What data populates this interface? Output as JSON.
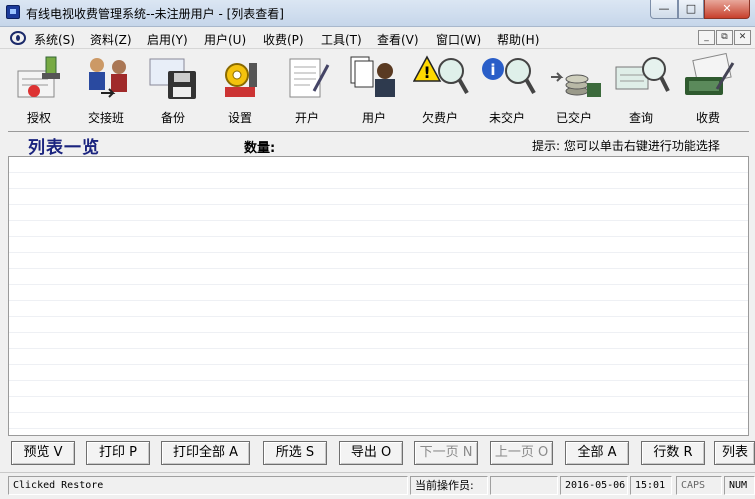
{
  "window": {
    "title": "有线电视收费管理系统--未注册用户 - [列表查看]"
  },
  "menu": [
    {
      "label": "系统(S)"
    },
    {
      "label": "资料(Z)"
    },
    {
      "label": "启用(Y)"
    },
    {
      "label": "用户(U)"
    },
    {
      "label": "收费(P)"
    },
    {
      "label": "工具(T)"
    },
    {
      "label": "查看(V)"
    },
    {
      "label": "窗口(W)"
    },
    {
      "label": "帮助(H)"
    }
  ],
  "toolbar": [
    {
      "label": "授权",
      "icon": "authorize-icon"
    },
    {
      "label": "交接班",
      "icon": "shift-handover-icon"
    },
    {
      "label": "备份",
      "icon": "backup-floppy-icon"
    },
    {
      "label": "设置",
      "icon": "settings-gear-icon"
    },
    {
      "label": "开户",
      "icon": "open-account-icon"
    },
    {
      "label": "用户",
      "icon": "users-icon"
    },
    {
      "label": "欠费户",
      "icon": "arrears-warning-icon"
    },
    {
      "label": "未交户",
      "icon": "unpaid-info-icon"
    },
    {
      "label": "已交户",
      "icon": "paid-coins-icon"
    },
    {
      "label": "查询",
      "icon": "search-magnifier-icon"
    },
    {
      "label": "收费",
      "icon": "charge-money-icon"
    }
  ],
  "list": {
    "title": "列表一览",
    "count_label": "数量:",
    "hint": "提示: 您可以单击右键进行功能选择"
  },
  "buttons": [
    {
      "label": "预览 V",
      "enabled": true
    },
    {
      "label": "打印 P",
      "enabled": true
    },
    {
      "label": "打印全部 A",
      "enabled": true
    },
    {
      "label": "所选 S",
      "enabled": true
    },
    {
      "label": "导出 O",
      "enabled": true
    },
    {
      "label": "下一页 N",
      "enabled": false
    },
    {
      "label": "上一页 O",
      "enabled": false
    },
    {
      "label": "全部 A",
      "enabled": true
    },
    {
      "label": "行数 R",
      "enabled": true
    },
    {
      "label": "列表",
      "enabled": true
    }
  ],
  "status": {
    "message": "Clicked Restore",
    "operator_label": "当前操作员:",
    "operator_value": "",
    "date": "2016-05-06",
    "time": "15:01",
    "caps": "CAPS",
    "num": "NUM"
  },
  "colors": {
    "title_accent": "#1a237e",
    "close_button": "#c7402c"
  }
}
